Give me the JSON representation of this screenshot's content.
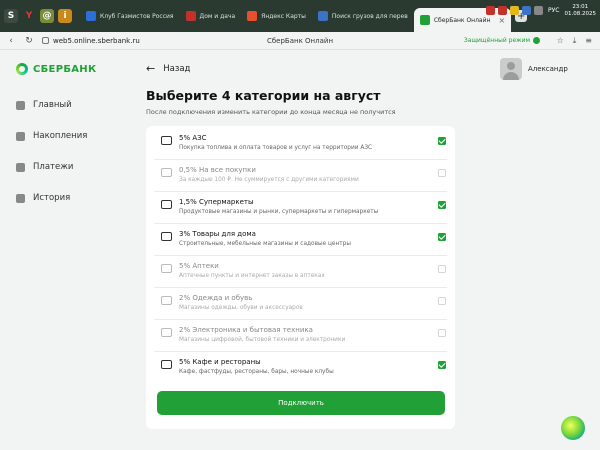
{
  "os": {
    "tabs": [
      {
        "label": "Клуб Газмистов Россия",
        "color": "#2c6fdb"
      },
      {
        "label": "Дом и дача",
        "color": "#c4312b"
      },
      {
        "label": "Яндекс Карты",
        "color": "#e94e2f"
      },
      {
        "label": "Поиск грузов для перев",
        "color": "#3b73c7"
      }
    ],
    "active_tab": "СберБанк Онлайн",
    "tray_lang": "РУС",
    "clock_time": "23:01",
    "clock_date": "01.08.2025"
  },
  "browser": {
    "url": "web5.online.sberbank.ru",
    "page_title": "СберБанк Онлайн",
    "secure_label": "Защищённый режим"
  },
  "brand": {
    "logo_text": "СБЕРБАНК",
    "accent": "#21a038"
  },
  "sidebar": {
    "items": [
      {
        "label": "Главный",
        "icon": "home-icon"
      },
      {
        "label": "Накопления",
        "icon": "savings-icon"
      },
      {
        "label": "Платежи",
        "icon": "payments-icon"
      },
      {
        "label": "История",
        "icon": "history-icon"
      }
    ]
  },
  "header": {
    "back_label": "Назад",
    "user_name": "Александр"
  },
  "main": {
    "title": "Выберите 4 категории на август",
    "subtitle": "После подключения изменить категории до конца месяца не получится",
    "categories": [
      {
        "title": "5% АЗС",
        "desc": "Покупка топлива и оплата товаров и услуг на территории АЗС",
        "checked": true,
        "icon": "car-icon"
      },
      {
        "title": "0,5% На все покупки",
        "desc": "За каждые 100 ₽. Не суммируется с другими категориями",
        "checked": false,
        "icon": "percent-icon"
      },
      {
        "title": "1,5% Супермаркеты",
        "desc": "Продуктовые магазины и рынки, супермаркеты и гипермаркеты",
        "checked": true,
        "icon": "basket-icon"
      },
      {
        "title": "3% Товары для дома",
        "desc": "Строительные, мебельные магазины и садовые центры",
        "checked": true,
        "icon": "lamp-icon"
      },
      {
        "title": "5% Аптеки",
        "desc": "Аптечные пункты и интернет заказы в аптеках",
        "checked": false,
        "icon": "pharmacy-icon"
      },
      {
        "title": "2% Одежда и обувь",
        "desc": "Магазины одежды, обуви и аксессуаров",
        "checked": false,
        "icon": "clothes-icon"
      },
      {
        "title": "2% Электроника и бытовая техника",
        "desc": "Магазины цифровой, бытовой техники и электроники",
        "checked": false,
        "icon": "monitor-icon"
      },
      {
        "title": "5% Кафе и рестораны",
        "desc": "Кафе, фастфуды, рестораны, бары, ночные клубы",
        "checked": true,
        "icon": "cutlery-icon"
      }
    ],
    "connect_label": "Подключить"
  }
}
